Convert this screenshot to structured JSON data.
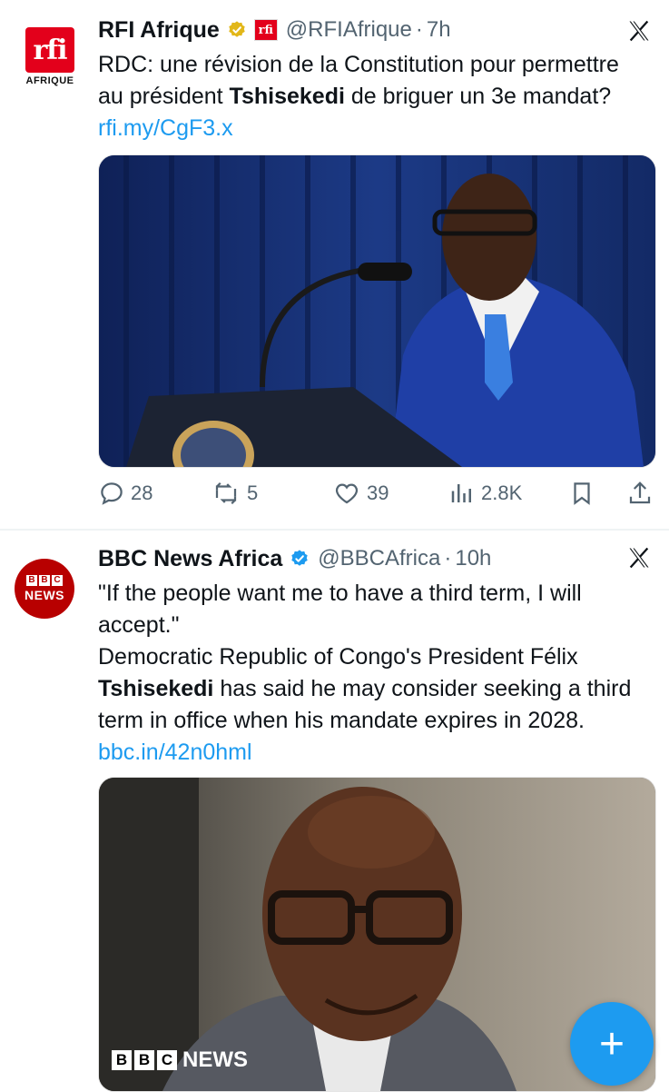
{
  "tweet1": {
    "avatar_text": "rfi",
    "avatar_sub": "AFRIQUE",
    "name": "RFI Afrique",
    "affiliate_badge": "rfi",
    "handle": "@RFIAfrique",
    "separator": "·",
    "time": "7h",
    "text_before": "RDC: une révision de la Constitution pour permettre au président ",
    "text_bold": "Tshisekedi",
    "text_after": " de briguer un 3e mandat? ",
    "link": "rfi.my/CgF3.x",
    "image_icon": "photo-president-speaking-at-podium",
    "actions": {
      "replies": "28",
      "reposts": "5",
      "likes": "39",
      "views": "2.8K"
    }
  },
  "tweet2": {
    "avatar_top": [
      "B",
      "B",
      "C"
    ],
    "avatar_bottom": "NEWS",
    "name": "BBC News Africa",
    "handle": "@BBCAfrica",
    "separator": "·",
    "time": "10h",
    "line1": "\"If the people want me to have a third term, I will accept.\"",
    "line2_before": "Democratic Republic of Congo's President Félix ",
    "line2_bold": "Tshisekedi",
    "line2_after": " has said he may consider seeking a third term in office when his mandate expires in 2028. ",
    "link": "bbc.in/42n0hml",
    "image_icon": "photo-portrait-smiling-man-glasses",
    "watermark_blocks": [
      "B",
      "B",
      "C"
    ],
    "watermark_news": "NEWS"
  },
  "fab": {
    "label": "+"
  },
  "colors": {
    "accent": "#1d9bf0",
    "rfi_red": "#e3001b",
    "bbc_red": "#b80000",
    "muted": "#536471"
  }
}
